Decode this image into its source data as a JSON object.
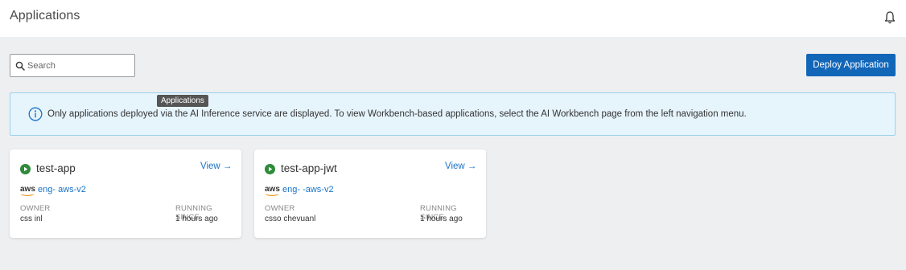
{
  "header": {
    "title": "Applications",
    "notification_icon": "bell-icon"
  },
  "toolbar": {
    "search_placeholder": "Search",
    "search_value": "",
    "deploy_label": "Deploy Application"
  },
  "tooltip": {
    "text": "Applications"
  },
  "banner": {
    "icon": "info-icon",
    "text": "Only applications deployed via the AI Inference service are displayed. To view Workbench-based applications, select the AI Workbench page from the left navigation menu."
  },
  "cards": [
    {
      "name": "test-app",
      "status": "running",
      "view_label": "View →",
      "provider": "aws",
      "cluster": "eng-        aws-v2",
      "owner_label": "OWNER",
      "owner": "css       inl",
      "since_label": "RUNNING SINCE",
      "since": "1 hours ago"
    },
    {
      "name": "test-app-jwt",
      "status": "running",
      "view_label": "View →",
      "provider": "aws",
      "cluster": "eng-               -aws-v2",
      "owner_label": "OWNER",
      "owner": "csso chevuanl",
      "since_label": "RUNNING SINCE",
      "since": "1 hours ago"
    }
  ],
  "colors": {
    "primary": "#1266b8",
    "link": "#1a73c8",
    "running": "#2e8b3a",
    "banner_bg": "#e6f4fc",
    "banner_border": "#9fd1ec",
    "aws_orange": "#f59a23",
    "content_bg": "#eeeff1"
  }
}
